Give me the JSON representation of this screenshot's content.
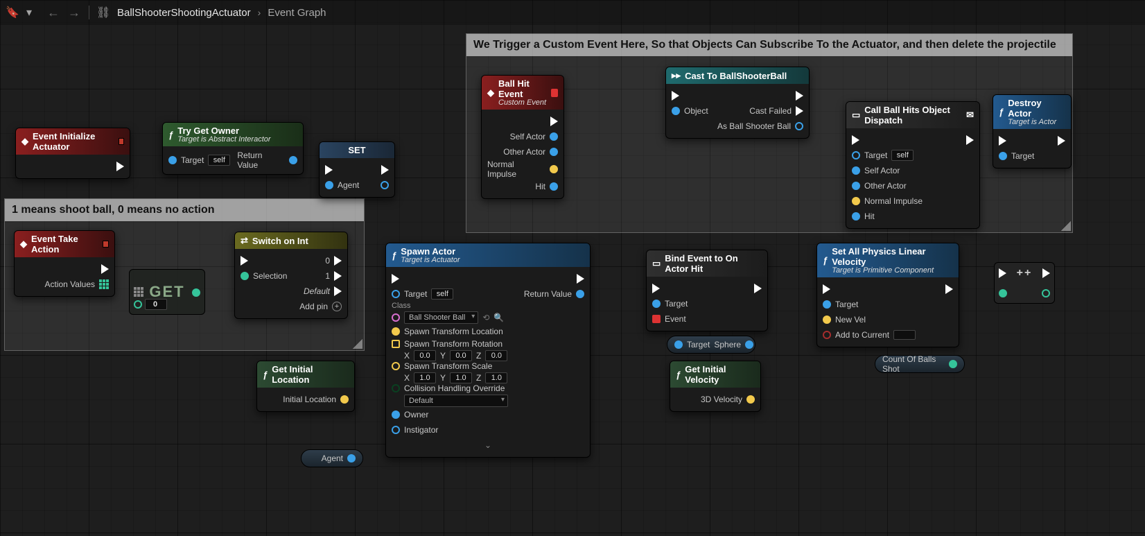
{
  "toolbar": {
    "crumb1": "BallShooterShootingActuator",
    "crumb2": "Event Graph"
  },
  "comments": {
    "c1": "We Trigger a Custom Event Here, So that Objects Can Subscribe To the Actuator, and then delete the projectile",
    "c2": "1 means shoot ball, 0 means no action"
  },
  "nodes": {
    "initActuator": {
      "title": "Event Initialize Actuator"
    },
    "tryGetOwner": {
      "title": "Try Get Owner",
      "sub": "Target is Abstract Interactor",
      "target": "Target",
      "self": "self",
      "ret": "Return Value"
    },
    "set": {
      "title": "SET",
      "agent": "Agent"
    },
    "takeAction": {
      "title": "Event Take Action",
      "av": "Action Values"
    },
    "get": {
      "title": "GET",
      "index": "0"
    },
    "switch": {
      "title": "Switch on Int",
      "sel": "Selection",
      "p0": "0",
      "p1": "1",
      "def": "Default",
      "add": "Add pin"
    },
    "getLoc": {
      "title": "Get Initial Location",
      "out": "Initial Location"
    },
    "agentVar": {
      "label": "Agent"
    },
    "spawn": {
      "title": "Spawn Actor",
      "sub": "Target is Actuator",
      "target": "Target",
      "self": "self",
      "class": "Class",
      "classVal": "Ball Shooter Ball",
      "loc": "Spawn Transform Location",
      "rot": "Spawn Transform Rotation",
      "rotX": "0.0",
      "rotY": "0.0",
      "rotZ": "0.0",
      "scl": "Spawn Transform Scale",
      "sclX": "1.0",
      "sclY": "1.0",
      "sclZ": "1.0",
      "col": "Collision Handling Override",
      "colVal": "Default",
      "owner": "Owner",
      "inst": "Instigator",
      "ret": "Return Value"
    },
    "bind": {
      "title": "Bind Event to On Actor Hit",
      "target": "Target",
      "event": "Event"
    },
    "tsphere": {
      "l": "Target",
      "r": "Sphere"
    },
    "getVel": {
      "title": "Get Initial Velocity",
      "out": "3D Velocity"
    },
    "setVel": {
      "title": "Set All Physics Linear Velocity",
      "sub": "Target is Primitive Component",
      "target": "Target",
      "new": "New Vel",
      "add": "Add to Current"
    },
    "count": {
      "label": "Count Of Balls Shot"
    },
    "ballHit": {
      "title": "Ball Hit Event",
      "sub": "Custom Event",
      "sa": "Self Actor",
      "oa": "Other Actor",
      "ni": "Normal Impulse",
      "hit": "Hit"
    },
    "cast": {
      "title": "Cast To BallShooterBall",
      "obj": "Object",
      "fail": "Cast Failed",
      "as": "As Ball Shooter Ball"
    },
    "dispatch": {
      "title": "Call Ball Hits Object Dispatch",
      "target": "Target",
      "self": "self",
      "sa": "Self Actor",
      "oa": "Other Actor",
      "ni": "Normal Impulse",
      "hit": "Hit"
    },
    "destroy": {
      "title": "Destroy Actor",
      "sub": "Target is Actor",
      "target": "Target"
    }
  }
}
